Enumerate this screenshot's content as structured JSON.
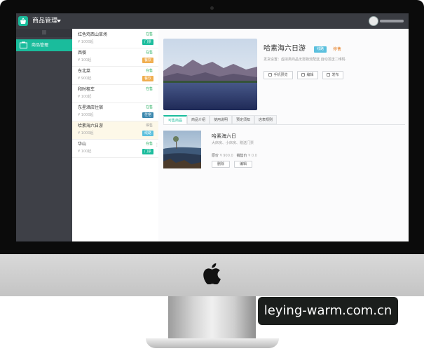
{
  "watermark": "leying-warm.com.cn",
  "app": {
    "title": "商品管理"
  },
  "sidebar": {
    "toggle": "|||",
    "items": [
      {
        "label": "商品管理"
      }
    ]
  },
  "product_list": [
    {
      "name": "红色鸡西山草场",
      "price": "¥ 1000起",
      "status": "在售",
      "tag": "门票",
      "tag_color": "#1abc9c"
    },
    {
      "name": "西餐",
      "price": "¥ 100起",
      "status": "在售",
      "tag": "餐饮",
      "tag_color": "#f0ad4e"
    },
    {
      "name": "东北菜",
      "price": "¥ 900起",
      "status": "在售",
      "tag": "餐饮",
      "tag_color": "#f0ad4e"
    },
    {
      "name": "和时租车",
      "price": "¥ 100起",
      "status": "在售",
      "tag": "",
      "tag_color": ""
    },
    {
      "name": "东星酒店住宿",
      "price": "¥ 1000起",
      "status": "在售",
      "tag": "住宿",
      "tag_color": "#3a87ad"
    },
    {
      "name": "哈素海六日游",
      "price": "¥ 1000起",
      "status": "停售",
      "tag": "线路",
      "tag_color": "#5bc0de"
    },
    {
      "name": "华山",
      "price": "¥ 100起",
      "status": "在售",
      "tag": "门票",
      "tag_color": "#1abc9c"
    }
  ],
  "detail": {
    "title": "哈素海六日游",
    "tag": "线路",
    "status": "停售",
    "description": "发货设置：虚拟类商品无需物流配送,自动发送二维码",
    "buttons": {
      "preview": "手机预览",
      "edit": "编辑",
      "publish": "发布"
    },
    "tabs": [
      "可售商品",
      "商品介绍",
      "使用说明",
      "预定须知",
      "店表规则"
    ],
    "sub_product": {
      "name": "哈素海六日",
      "description": "大床房、小床房、赠送门票",
      "price_label": "原价",
      "price": "¥ 900.0",
      "sale_label": "销售价",
      "sale_price": "¥ 0.0",
      "delete": "删除",
      "edit": "编辑"
    }
  }
}
